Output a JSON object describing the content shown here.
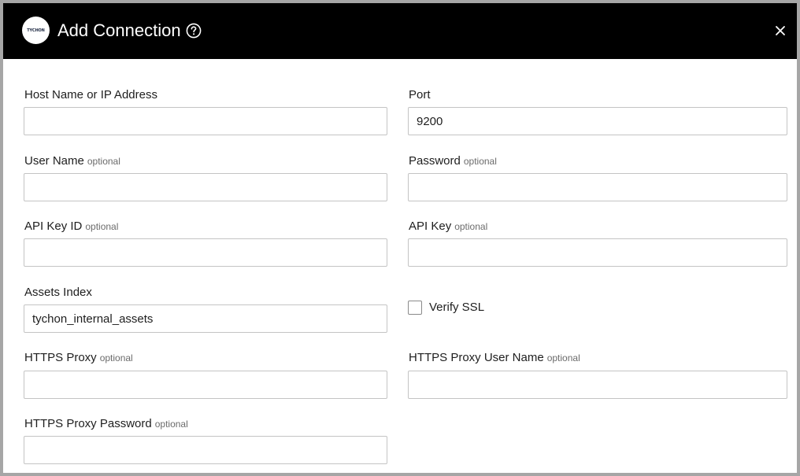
{
  "header": {
    "logo_text": "TYCHON",
    "title": "Add Connection",
    "help_icon": "help-circle-icon",
    "close_icon": "close-icon"
  },
  "form": {
    "host": {
      "label": "Host Name or IP Address",
      "value": ""
    },
    "port": {
      "label": "Port",
      "value": "9200"
    },
    "user_name": {
      "label": "User Name",
      "optional": "optional",
      "value": ""
    },
    "password": {
      "label": "Password",
      "optional": "optional",
      "value": ""
    },
    "api_key_id": {
      "label": "API Key ID",
      "optional": "optional",
      "value": ""
    },
    "api_key": {
      "label": "API Key",
      "optional": "optional",
      "value": ""
    },
    "assets_index": {
      "label": "Assets Index",
      "value": "tychon_internal_assets"
    },
    "verify_ssl": {
      "label": "Verify SSL",
      "checked": false
    },
    "https_proxy": {
      "label": "HTTPS Proxy",
      "optional": "optional",
      "value": ""
    },
    "https_proxy_user": {
      "label": "HTTPS Proxy User Name",
      "optional": "optional",
      "value": ""
    },
    "https_proxy_password": {
      "label": "HTTPS Proxy Password",
      "optional": "optional",
      "value": ""
    }
  }
}
